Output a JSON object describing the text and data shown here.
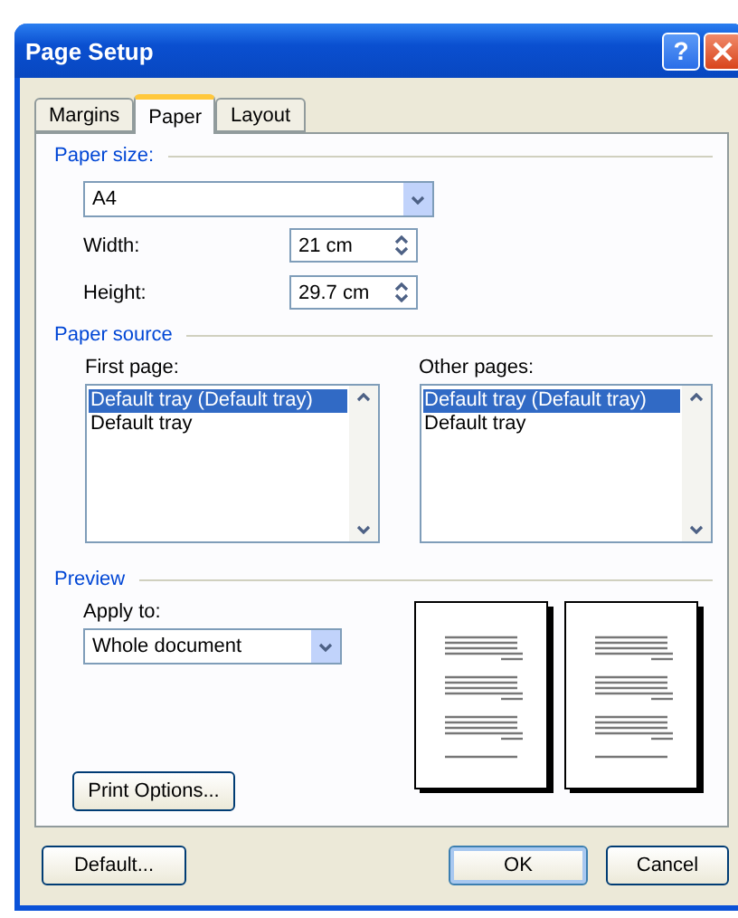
{
  "window": {
    "title": "Page Setup",
    "help": "?"
  },
  "tabs": [
    {
      "label": "Margins",
      "selected": false
    },
    {
      "label": "Paper",
      "selected": true
    },
    {
      "label": "Layout",
      "selected": false
    }
  ],
  "paper_size": {
    "heading": "Paper size:",
    "size": "A4",
    "width_label": "Width:",
    "width": "21 cm",
    "height_label": "Height:",
    "height": "29.7 cm"
  },
  "paper_source": {
    "heading": "Paper source",
    "lists": [
      {
        "label": "First page:",
        "items": [
          {
            "text": "Default tray (Default tray)",
            "selected": true
          },
          {
            "text": "Default tray",
            "selected": false
          }
        ]
      },
      {
        "label": "Other pages:",
        "items": [
          {
            "text": "Default tray (Default tray)",
            "selected": true
          },
          {
            "text": "Default tray",
            "selected": false
          }
        ]
      }
    ]
  },
  "preview": {
    "heading": "Preview",
    "apply_label": "Apply to:",
    "apply_value": "Whole document",
    "print_options": "Print Options..."
  },
  "buttons": [
    {
      "label": "Default...",
      "focused": false
    },
    {
      "label": "OK",
      "focused": true
    },
    {
      "label": "Cancel",
      "focused": false
    }
  ]
}
